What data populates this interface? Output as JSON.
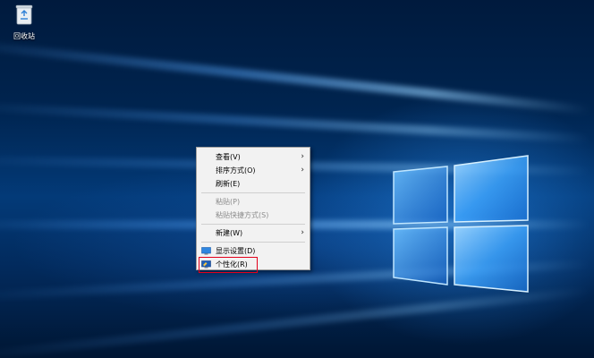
{
  "desktop": {
    "icons": [
      {
        "label": "回收站",
        "icon": "recycle-bin-icon"
      }
    ]
  },
  "context_menu": {
    "items": [
      {
        "label": "查看(V)",
        "submenu": true
      },
      {
        "label": "排序方式(O)",
        "submenu": true
      },
      {
        "label": "刷新(E)"
      },
      {
        "label": "粘贴(P)",
        "disabled": true
      },
      {
        "label": "粘贴快捷方式(S)",
        "disabled": true
      },
      {
        "label": "新建(W)",
        "submenu": true
      },
      {
        "label": "显示设置(D)",
        "icon": "display-settings-icon"
      },
      {
        "label": "个性化(R)",
        "icon": "personalize-icon",
        "highlighted": true
      }
    ],
    "submenu_arrow": "›",
    "highlight_color": "#e3001b"
  },
  "wallpaper": {
    "accent": "#1e8cff",
    "background": "#02346e"
  }
}
